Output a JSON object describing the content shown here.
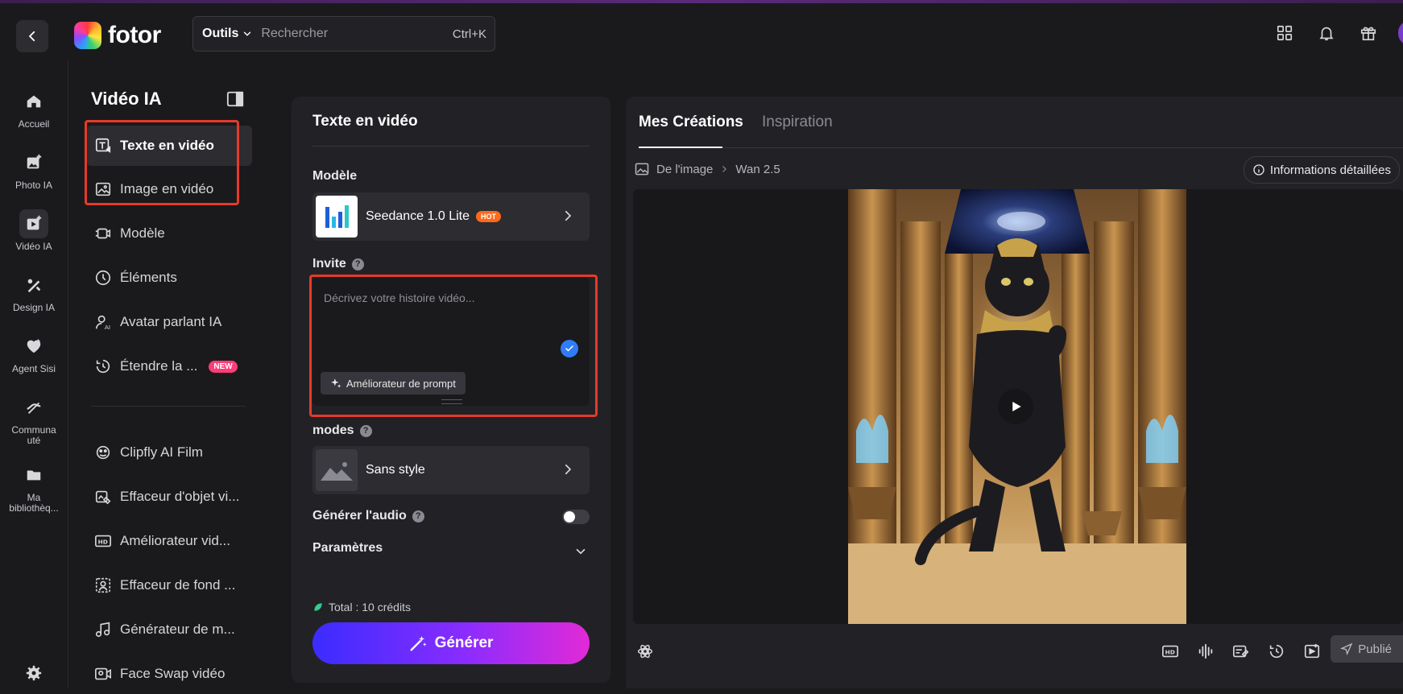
{
  "header": {
    "logo_text": "fotor",
    "search": {
      "tools_label": "Outils",
      "placeholder": "Rechercher",
      "shortcut": "Ctrl+K"
    }
  },
  "rail": {
    "items": [
      {
        "label": "Accueil",
        "icon": "home-icon"
      },
      {
        "label": "Photo IA",
        "icon": "photo-ai-icon"
      },
      {
        "label": "Vidéo IA",
        "icon": "video-ai-icon",
        "active": true
      },
      {
        "label": "Design IA",
        "icon": "design-ai-icon"
      },
      {
        "label": "Agent Sisi",
        "icon": "agent-icon"
      },
      {
        "label": "Communauté",
        "label_line1": "Communa",
        "label_line2": "uté",
        "icon": "community-icon"
      },
      {
        "label": "Ma bibliothèque",
        "label_line1": "Ma",
        "label_line2": "bibliothèq...",
        "icon": "folder-icon"
      }
    ]
  },
  "sidebar": {
    "title": "Vidéo IA",
    "items": [
      {
        "label": "Texte en vidéo",
        "icon": "text-to-video-icon",
        "active": true
      },
      {
        "label": "Image en vidéo",
        "icon": "image-to-video-icon"
      },
      {
        "label": "Modèle",
        "icon": "template-icon"
      },
      {
        "label": "Éléments",
        "icon": "elements-icon"
      },
      {
        "label": "Avatar parlant IA",
        "icon": "avatar-ai-icon"
      },
      {
        "label": "Étendre la ...",
        "icon": "extend-icon",
        "badge": "NEW"
      },
      {
        "label": "Clipfly AI Film",
        "icon": "clipfly-icon"
      },
      {
        "label": "Effaceur d'objet vi...",
        "icon": "object-eraser-icon"
      },
      {
        "label": "Améliorateur vid...",
        "icon": "hd-icon"
      },
      {
        "label": "Effaceur de fond ...",
        "icon": "bg-eraser-icon"
      },
      {
        "label": "Générateur de m...",
        "icon": "music-icon"
      },
      {
        "label": "Face Swap vidéo",
        "icon": "face-swap-icon"
      }
    ]
  },
  "form": {
    "title": "Texte en vidéo",
    "model_label": "Modèle",
    "model_name": "Seedance 1.0 Lite",
    "model_badge": "HOT",
    "prompt_label": "Invite",
    "prompt_placeholder": "Décrivez votre histoire vidéo...",
    "prompt_enhancer": "Améliorateur de prompt",
    "modes_label": "modes",
    "style_name": "Sans style",
    "audio_label": "Générer l'audio",
    "audio_enabled": false,
    "params_label": "Paramètres",
    "credits": "Total : 10 crédits",
    "generate_label": "Générer"
  },
  "preview": {
    "tabs": [
      {
        "label": "Mes Créations",
        "active": true
      },
      {
        "label": "Inspiration",
        "active": false
      }
    ],
    "breadcrumb": [
      "De l'image",
      "Wan 2.5"
    ],
    "info_label": "Informations détaillées",
    "publish_label": "Publié"
  },
  "colors": {
    "accent_blue": "#2f7cf6",
    "hot_badge": "#ff6a1a",
    "new_badge": "#ff3b7a",
    "highlight_box": "#e53a2a"
  }
}
